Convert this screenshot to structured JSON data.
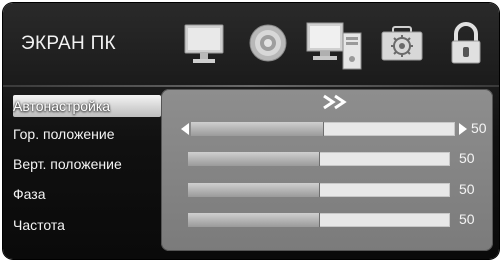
{
  "header": {
    "title": "ЭКРАН ПК",
    "icons": [
      "monitor-icon",
      "sound-icon",
      "pc-icon",
      "settings-icon",
      "lock-icon"
    ]
  },
  "menu": {
    "items": [
      {
        "label": "Автонастройка",
        "selected": true
      },
      {
        "label": "Гор. положение",
        "selected": false
      },
      {
        "label": "Верт. положение",
        "selected": false
      },
      {
        "label": "Фаза",
        "selected": false
      },
      {
        "label": "Частота",
        "selected": false
      }
    ]
  },
  "panel": {
    "auto_icon": "double-chevron-right-icon",
    "sliders": [
      {
        "name": "Гор. положение",
        "value": "50",
        "level": 0.5
      },
      {
        "name": "Верт. положение",
        "value": "50",
        "level": 0.5
      },
      {
        "name": "Фаза",
        "value": "50",
        "level": 0.5
      },
      {
        "name": "Частота",
        "value": "50",
        "level": 0.5
      }
    ]
  },
  "colors": {
    "background": "#101010",
    "panel": "#858585",
    "text": "#f4f4f4",
    "slider_track": "#e8e8e8",
    "slider_fill": "#b0b0b0"
  }
}
